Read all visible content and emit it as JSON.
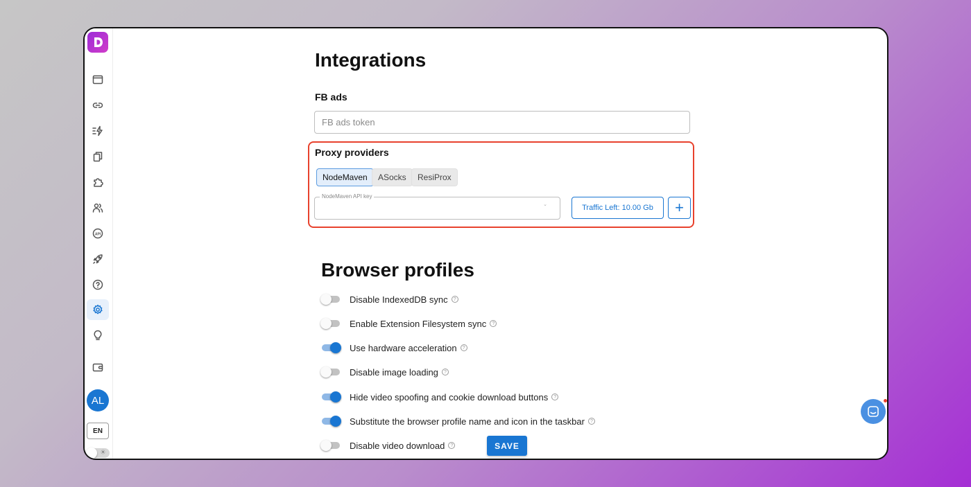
{
  "sidebar": {
    "logo_icon": "dolphin-logo-icon",
    "items": [
      {
        "name": "browser-window-icon"
      },
      {
        "name": "link-icon"
      },
      {
        "name": "automation-icon"
      },
      {
        "name": "copy-icon"
      },
      {
        "name": "puzzle-icon"
      },
      {
        "name": "users-icon"
      },
      {
        "name": "api-icon",
        "text": "API"
      },
      {
        "name": "rocket-icon"
      },
      {
        "name": "help-circle-icon"
      },
      {
        "name": "gear-icon",
        "active": true
      },
      {
        "name": "lightbulb-icon"
      },
      {
        "name": "wallet-icon"
      }
    ],
    "avatar": "AL",
    "language": "EN"
  },
  "integrations": {
    "title": "Integrations",
    "fb": {
      "label": "FB ads",
      "placeholder": "FB ads token"
    },
    "proxy": {
      "label": "Proxy providers",
      "tabs": [
        "NodeMaven",
        "ASocks",
        "ResiProx"
      ],
      "selected": "NodeMaven",
      "api_key_label": "NodeMaven API key",
      "traffic_label": "Traffic Left: 10.00 Gb",
      "add_label": "+"
    },
    "highlight_color": "#e8412c"
  },
  "browser_profiles": {
    "title": "Browser profiles",
    "toggles": [
      {
        "label": "Disable IndexedDB sync",
        "on": false
      },
      {
        "label": "Enable Extension Filesystem sync",
        "on": false
      },
      {
        "label": "Use hardware acceleration",
        "on": true
      },
      {
        "label": "Disable image loading",
        "on": false
      },
      {
        "label": "Hide video spoofing and cookie download buttons",
        "on": true
      },
      {
        "label": "Substitute the browser profile name and icon in the taskbar",
        "on": true
      },
      {
        "label": "Disable video download",
        "on": false
      }
    ],
    "help_glyph": "?",
    "save_label": "SAVE"
  },
  "colors": {
    "accent": "#1976d2",
    "brand": "#9c2bd8"
  }
}
